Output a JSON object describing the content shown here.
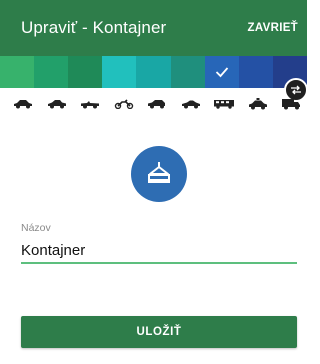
{
  "appbar": {
    "title": "Upraviť - Kontajner",
    "close_label": "ZAVRIEŤ"
  },
  "colors": {
    "swatches": [
      "#37b26c",
      "#22a06a",
      "#1f8a58",
      "#21c0bd",
      "#19a7a5",
      "#1f8f7d",
      "#2766b8",
      "#2451a5",
      "#233e8b"
    ],
    "selected_index": 6
  },
  "vehicles": [
    "car-icon",
    "sedan-icon",
    "convertible-icon",
    "motorcycle-icon",
    "hatchback-icon",
    "coupe-icon",
    "bus-icon",
    "police-car-icon",
    "truck-icon"
  ],
  "badge": {
    "icon": "container-crane-icon",
    "color": "#2e6db3"
  },
  "form": {
    "name_label": "Názov",
    "name_value": "Kontajner"
  },
  "actions": {
    "save_label": "ULOŽIŤ"
  },
  "accent": "#2e7d4a"
}
